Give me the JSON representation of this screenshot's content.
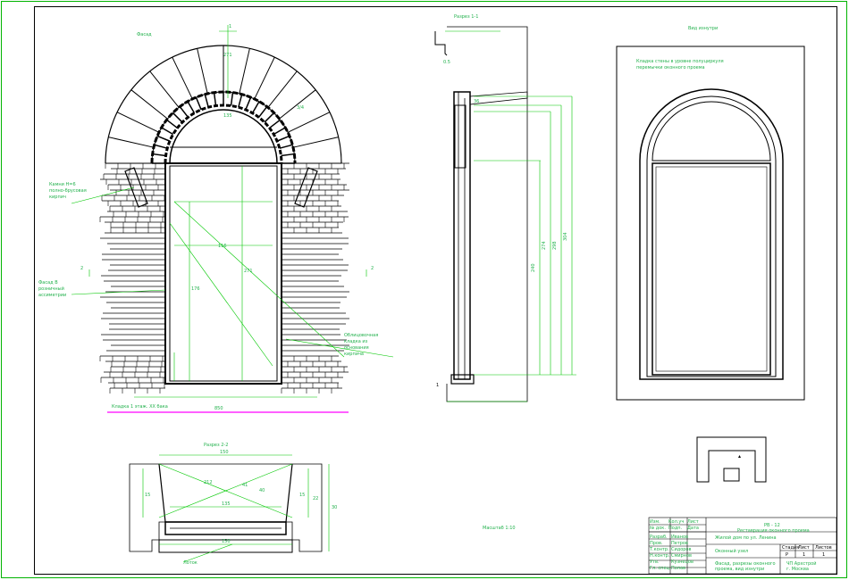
{
  "colors": {
    "line": "#000000",
    "dimension": "#00c800",
    "frame": "#00b400",
    "label": "#22b14c",
    "accent": "#ff00ff"
  },
  "views": {
    "facade": {
      "title": "Фасад",
      "grid_left": "2",
      "grid_right": "2"
    },
    "section_1": {
      "title": "Разрез 1-1"
    },
    "inside_view": {
      "title": "Вид изнутри",
      "note_line1": "Кладка стены в уровне полуциркуля",
      "note_line2": "перемычки оконного проема"
    },
    "section_2": {
      "title": "Разрез 2-2"
    }
  },
  "dimensions": {
    "facade": {
      "top_grid": "1",
      "arch_top": "271",
      "arch_side": "3/4",
      "arch_inner": "135",
      "opening_width": "116",
      "opening_height": "271",
      "lower_height": "176",
      "diag": "212",
      "bottom": "850",
      "left_small": "15",
      "right_small": "15"
    },
    "section_1": {
      "top_mark": "0.5",
      "d1": "240",
      "d2": "274",
      "d3": "298",
      "d4": "304",
      "small_top": "36",
      "bottom": "1"
    },
    "section_2": {
      "top": "150",
      "inner": "135",
      "d1": "212",
      "d2": "41",
      "d3": "40",
      "side_left": "15",
      "side_right": "15",
      "right": "22",
      "depth": "30",
      "bottom": "150"
    }
  },
  "callouts": {
    "stone_note": [
      "Камни Н=6",
      "полно-брусовая",
      "кирпич"
    ],
    "plaster_note": [
      "Фасад В",
      "розничный",
      "ассиметрии"
    ],
    "right_note": [
      "Облицовочная",
      "кладка из",
      "основания",
      "кирпича"
    ],
    "ground_note": "Кладка 1 этаж. XX бака",
    "lintel_note": "Лоток",
    "scale_note": "Масштаб 1:10"
  },
  "title_block": {
    "code": "РВ - 12",
    "project": "Реставрация оконного проема",
    "building": "Жилой дом по ул. Ленина",
    "sheet_title": "Оконный узел",
    "stage_label": "Стадия",
    "sheet_label": "Лист",
    "sheets_label": "Листов",
    "stage": "Р",
    "sheet": "1",
    "sheets": "1",
    "drawing_line1": "Фасад, разрезы оконного",
    "drawing_line2": "проема, вид изнутри",
    "org_line1": "ЧП Архстрой",
    "org_line2": "г. Москва",
    "roles": [
      "Разраб.",
      "Пров.",
      "Т.контр.",
      "Н.контр.",
      "Утв.",
      "Гл. спец."
    ],
    "names": [
      "Иванов",
      "Петров",
      "Сидоров",
      "Смирнов",
      "Кузнецов",
      "Попов"
    ],
    "change_headers": [
      "Изм.",
      "Кол.уч",
      "Лист",
      "№ док.",
      "Подп.",
      "Дата"
    ]
  }
}
